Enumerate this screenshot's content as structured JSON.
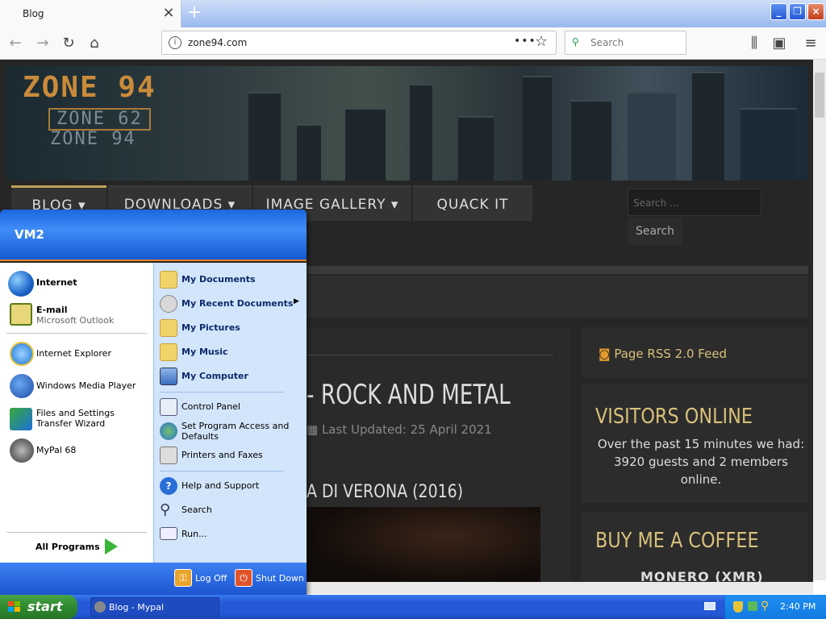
{
  "browser": {
    "tab_title": "Blog",
    "url": "zone94.com",
    "search_placeholder": "Search",
    "tab_close_glyph": "×",
    "new_tab_glyph": "+"
  },
  "site": {
    "logo_main": "ZONE 94",
    "logo_sub1": "ZONE 62",
    "logo_sub2": "ZONE 94",
    "menu": [
      {
        "label": "BLOG",
        "dropdown": true
      },
      {
        "label": "DOWNLOADS",
        "dropdown": true
      },
      {
        "label": "IMAGE GALLERY",
        "dropdown": true
      },
      {
        "label": "QUACK IT",
        "dropdown": false
      }
    ],
    "search_placeholder": "Search ...",
    "search_button": "Search",
    "article_title": "- ROCK AND METAL",
    "article_updated": "Last Updated: 25 April 2021",
    "article_subtitle": "A DI VERONA (2016)",
    "rss_label": "Page RSS 2.0 Feed",
    "visitors_title": "VISITORS ONLINE",
    "visitors_text": "Over the past 15 minutes we had: 3920 guests and 2 members online.",
    "coffee_title": "BUY ME A COFFEE",
    "monero_label": "MONERO (XMR)"
  },
  "start_menu": {
    "user": "VM2",
    "pinned": [
      {
        "label": "Internet",
        "icon": "globe-icon"
      },
      {
        "label": "E-mail",
        "sublabel": "Microsoft Outlook",
        "icon": "email-icon"
      }
    ],
    "recent": [
      {
        "label": "Internet Explorer",
        "icon": "ie-icon"
      },
      {
        "label": "Windows Media Player",
        "icon": "media-player-icon"
      },
      {
        "label": "Files and Settings Transfer Wizard",
        "icon": "transfer-wizard-icon"
      },
      {
        "label": "MyPal 68",
        "icon": "mypal-icon"
      }
    ],
    "all_programs": "All Programs",
    "places": [
      {
        "label": "My Documents",
        "bold": true,
        "icon": "folder-icon"
      },
      {
        "label": "My Recent Documents",
        "bold": true,
        "icon": "recent-docs-icon",
        "submenu": true
      },
      {
        "label": "My Pictures",
        "bold": true,
        "icon": "folder-icon"
      },
      {
        "label": "My Music",
        "bold": true,
        "icon": "folder-icon"
      },
      {
        "label": "My Computer",
        "bold": true,
        "icon": "computer-icon"
      }
    ],
    "system": [
      {
        "label": "Control Panel",
        "icon": "control-panel-icon"
      },
      {
        "label": "Set Program Access and Defaults",
        "icon": "program-access-icon"
      },
      {
        "label": "Printers and Faxes",
        "icon": "printer-icon"
      }
    ],
    "support": [
      {
        "label": "Help and Support",
        "icon": "help-icon"
      },
      {
        "label": "Search",
        "icon": "search-icon"
      },
      {
        "label": "Run...",
        "icon": "run-icon"
      }
    ],
    "log_off": "Log Off",
    "shut_down": "Shut Down"
  },
  "taskbar": {
    "start_label": "start",
    "task_item": "Blog - Mypal",
    "clock": "2:40 PM"
  },
  "colors": {
    "xp_blue": "#2458d6",
    "start_green": "#2f8a2f",
    "site_gold": "#d8c07a"
  }
}
